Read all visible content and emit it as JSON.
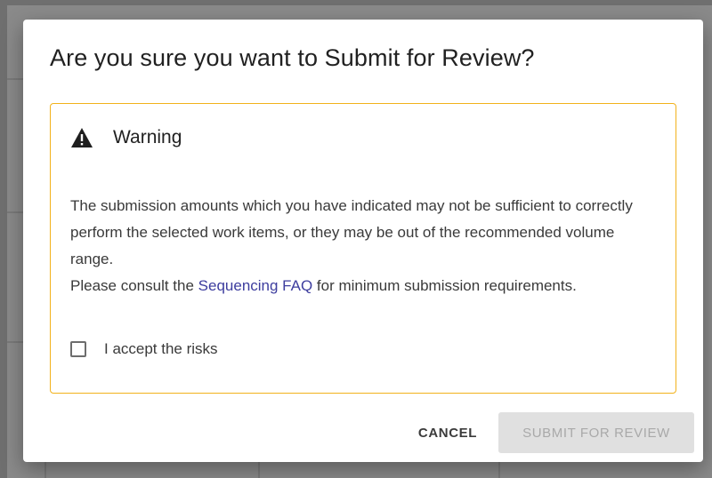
{
  "dialog": {
    "title": "Are you sure you want to Submit for Review?",
    "warning": {
      "icon": "warning-triangle-icon",
      "heading": "Warning",
      "message_line1": "The submission amounts which you have indicated may not be sufficient to correctly perform the selected work items, or they may be out of the recommended volume range.",
      "consult_prefix": "Please consult the ",
      "link_text": "Sequencing FAQ",
      "consult_suffix": " for minimum submission requirements.",
      "accept_label": "I accept the risks",
      "accept_checked": false,
      "border_color": "#f2b21b"
    },
    "actions": {
      "cancel_label": "CANCEL",
      "submit_label": "SUBMIT FOR REVIEW",
      "submit_disabled": true
    }
  }
}
